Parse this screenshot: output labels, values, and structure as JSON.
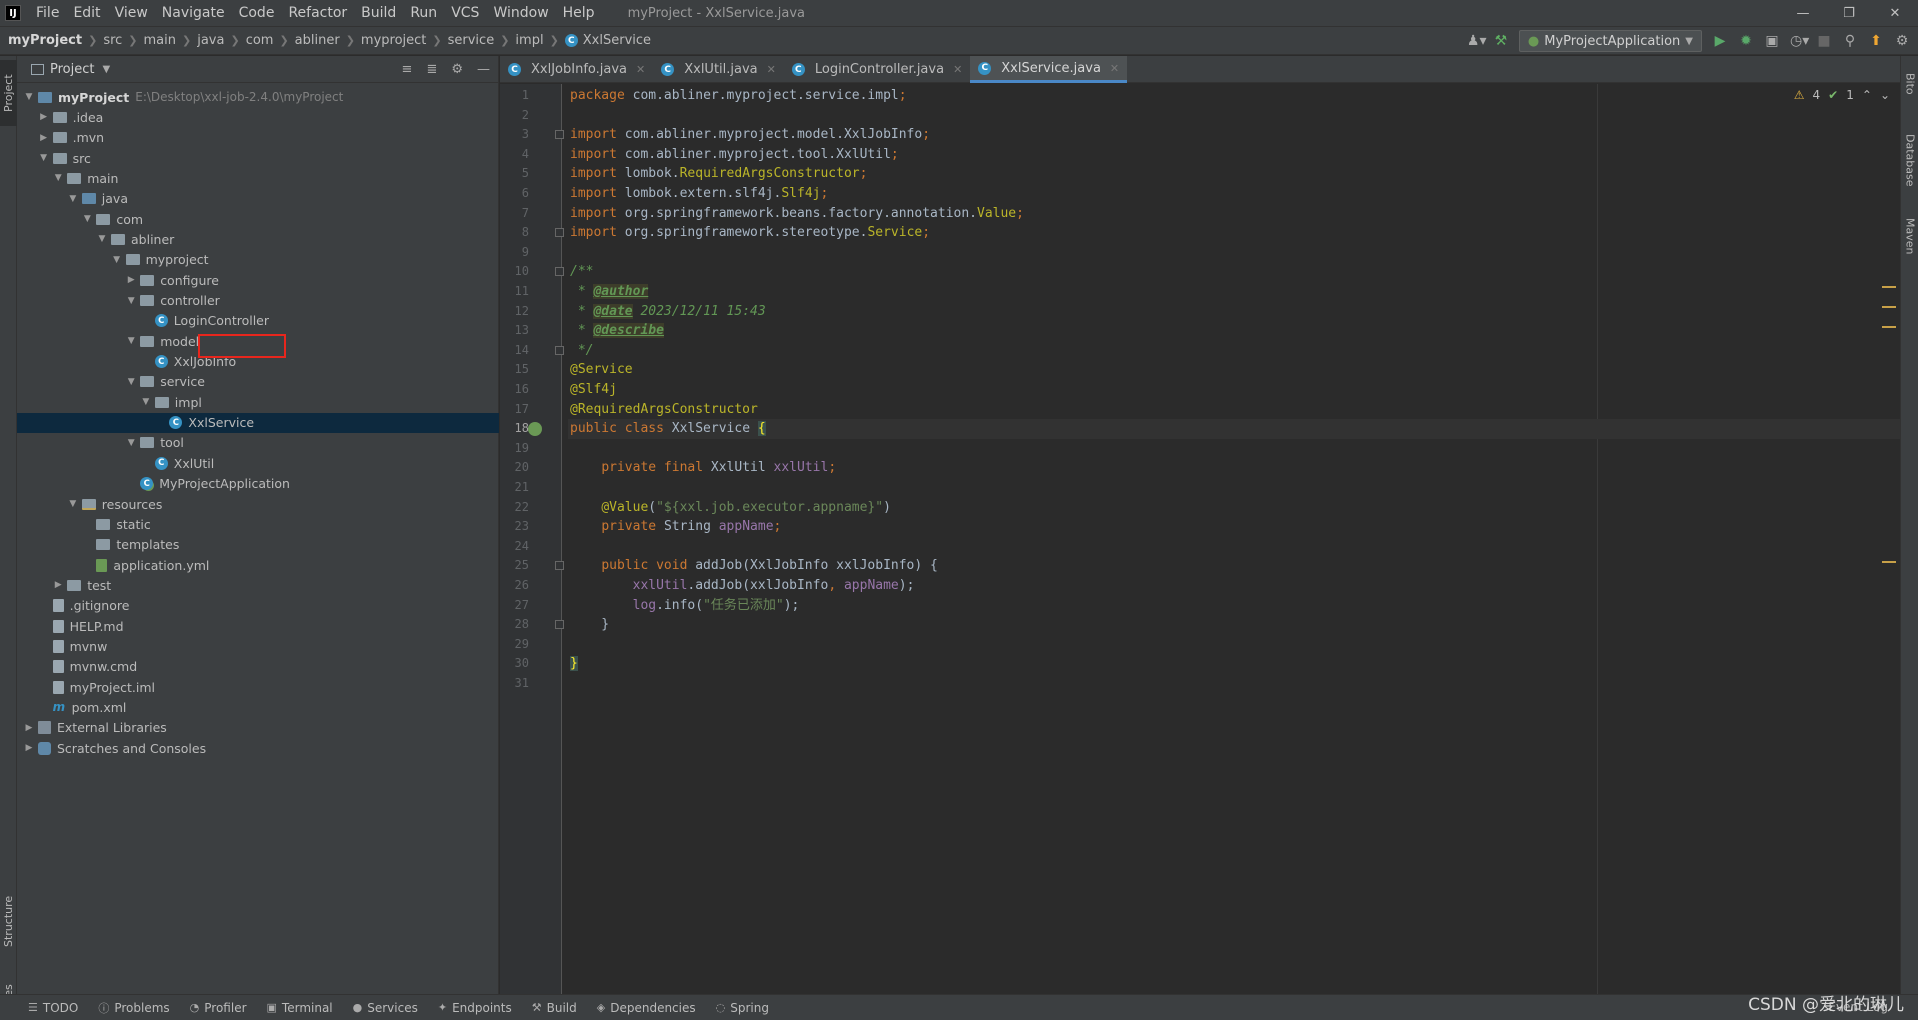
{
  "menubar": {
    "logo": "IJ",
    "items": [
      "File",
      "Edit",
      "View",
      "Navigate",
      "Code",
      "Refactor",
      "Build",
      "Run",
      "VCS",
      "Window",
      "Help"
    ],
    "window_title": "myProject - XxlService.java"
  },
  "breadcrumb": [
    "myProject",
    "src",
    "main",
    "java",
    "com",
    "abliner",
    "myproject",
    "service",
    "impl",
    "XxlService"
  ],
  "run_config": "MyProjectApplication",
  "left_tabs": {
    "project": "Project",
    "structure": "Structure",
    "favorites": "Favorites"
  },
  "right_tabs": {
    "bito": "Bito",
    "database": "Database",
    "maven": "Maven"
  },
  "project_panel": {
    "title": "Project"
  },
  "tree": [
    {
      "label": "myProject",
      "hint": "E:\\Desktop\\xxl-job-2.4.0\\myProject",
      "depth": 0,
      "arrow": "down",
      "icon": "folder-blue",
      "bold": true
    },
    {
      "label": ".idea",
      "depth": 1,
      "arrow": "right",
      "icon": "folder"
    },
    {
      "label": ".mvn",
      "depth": 1,
      "arrow": "right",
      "icon": "folder"
    },
    {
      "label": "src",
      "depth": 1,
      "arrow": "down",
      "icon": "folder"
    },
    {
      "label": "main",
      "depth": 2,
      "arrow": "down",
      "icon": "folder"
    },
    {
      "label": "java",
      "depth": 3,
      "arrow": "down",
      "icon": "folder-blue"
    },
    {
      "label": "com",
      "depth": 4,
      "arrow": "down",
      "icon": "folder"
    },
    {
      "label": "abliner",
      "depth": 5,
      "arrow": "down",
      "icon": "folder"
    },
    {
      "label": "myproject",
      "depth": 6,
      "arrow": "down",
      "icon": "folder"
    },
    {
      "label": "configure",
      "depth": 7,
      "arrow": "right",
      "icon": "folder"
    },
    {
      "label": "controller",
      "depth": 7,
      "arrow": "down",
      "icon": "folder"
    },
    {
      "label": "LoginController",
      "depth": 8,
      "arrow": "none",
      "icon": "class"
    },
    {
      "label": "model",
      "depth": 7,
      "arrow": "down",
      "icon": "folder"
    },
    {
      "label": "XxlJobInfo",
      "depth": 8,
      "arrow": "none",
      "icon": "class"
    },
    {
      "label": "service",
      "depth": 7,
      "arrow": "down",
      "icon": "folder"
    },
    {
      "label": "impl",
      "depth": 8,
      "arrow": "down",
      "icon": "folder"
    },
    {
      "label": "XxlService",
      "depth": 9,
      "arrow": "none",
      "icon": "class",
      "selected": true
    },
    {
      "label": "tool",
      "depth": 7,
      "arrow": "down",
      "icon": "folder"
    },
    {
      "label": "XxlUtil",
      "depth": 8,
      "arrow": "none",
      "icon": "class"
    },
    {
      "label": "MyProjectApplication",
      "depth": 7,
      "arrow": "none",
      "icon": "class-spring"
    },
    {
      "label": "resources",
      "depth": 3,
      "arrow": "down",
      "icon": "folder-res"
    },
    {
      "label": "static",
      "depth": 4,
      "arrow": "none",
      "icon": "folder"
    },
    {
      "label": "templates",
      "depth": 4,
      "arrow": "none",
      "icon": "folder"
    },
    {
      "label": "application.yml",
      "depth": 4,
      "arrow": "none",
      "icon": "yml"
    },
    {
      "label": "test",
      "depth": 2,
      "arrow": "right",
      "icon": "folder"
    },
    {
      "label": ".gitignore",
      "depth": 1,
      "arrow": "none",
      "icon": "file"
    },
    {
      "label": "HELP.md",
      "depth": 1,
      "arrow": "none",
      "icon": "file"
    },
    {
      "label": "mvnw",
      "depth": 1,
      "arrow": "none",
      "icon": "file"
    },
    {
      "label": "mvnw.cmd",
      "depth": 1,
      "arrow": "none",
      "icon": "file"
    },
    {
      "label": "myProject.iml",
      "depth": 1,
      "arrow": "none",
      "icon": "file"
    },
    {
      "label": "pom.xml",
      "depth": 1,
      "arrow": "none",
      "icon": "maven"
    },
    {
      "label": "External Libraries",
      "depth": 0,
      "arrow": "right",
      "icon": "lib"
    },
    {
      "label": "Scratches and Consoles",
      "depth": 0,
      "arrow": "right",
      "icon": "scratch"
    }
  ],
  "editor_tabs": [
    {
      "label": "XxlJobInfo.java",
      "active": false
    },
    {
      "label": "XxlUtil.java",
      "active": false
    },
    {
      "label": "LoginController.java",
      "active": false
    },
    {
      "label": "XxlService.java",
      "active": true
    }
  ],
  "inspections": {
    "warnings": "4",
    "weak_warnings": "1"
  },
  "code_lines": [
    [
      [
        "kw",
        "package "
      ],
      [
        "",
        "com.abliner.myproject.service.impl"
      ],
      [
        "kw",
        ";"
      ]
    ],
    [],
    [
      [
        "kw",
        "import "
      ],
      [
        "",
        "com.abliner.myproject.model.XxlJobInfo"
      ],
      [
        "kw",
        ";"
      ]
    ],
    [
      [
        "kw",
        "import "
      ],
      [
        "",
        "com.abliner.myproject.tool.XxlUtil"
      ],
      [
        "kw",
        ";"
      ]
    ],
    [
      [
        "kw",
        "import "
      ],
      [
        "",
        "lombok."
      ],
      [
        "ann",
        "RequiredArgsConstructor"
      ],
      [
        "kw",
        ";"
      ]
    ],
    [
      [
        "kw",
        "import "
      ],
      [
        "",
        "lombok.extern.slf4j."
      ],
      [
        "ann",
        "Slf4j"
      ],
      [
        "kw",
        ";"
      ]
    ],
    [
      [
        "kw",
        "import "
      ],
      [
        "",
        "org.springframework.beans.factory.annotation."
      ],
      [
        "ann",
        "Value"
      ],
      [
        "kw",
        ";"
      ]
    ],
    [
      [
        "kw",
        "import "
      ],
      [
        "",
        "org.springframework.stereotype."
      ],
      [
        "ann",
        "Service"
      ],
      [
        "kw",
        ";"
      ]
    ],
    [],
    [
      [
        "cmt",
        "/**"
      ]
    ],
    [
      [
        "cmt",
        " * "
      ],
      [
        "tag",
        "@author"
      ]
    ],
    [
      [
        "cmt",
        " * "
      ],
      [
        "tag",
        "@date"
      ],
      [
        "cmt",
        " 2023/12/11 15:43"
      ]
    ],
    [
      [
        "cmt",
        " * "
      ],
      [
        "tag",
        "@describe"
      ]
    ],
    [
      [
        "cmt",
        " */"
      ]
    ],
    [
      [
        "ann",
        "@Service"
      ]
    ],
    [
      [
        "ann",
        "@Slf4j"
      ]
    ],
    [
      [
        "ann",
        "@RequiredArgsConstructor"
      ]
    ],
    [
      [
        "kw",
        "public class "
      ],
      [
        "",
        "XxlService "
      ],
      [
        "brace",
        "{"
      ]
    ],
    [],
    [
      [
        "",
        "    "
      ],
      [
        "kw",
        "private final "
      ],
      [
        "",
        "XxlUtil "
      ],
      [
        "fld",
        "xxlUtil"
      ],
      [
        "kw",
        ";"
      ]
    ],
    [],
    [
      [
        "",
        "    "
      ],
      [
        "ann",
        "@Value"
      ],
      [
        "",
        "("
      ],
      [
        "str",
        "\"${xxl.job.executor.appname}\""
      ],
      [
        "",
        ")"
      ]
    ],
    [
      [
        "",
        "    "
      ],
      [
        "kw",
        "private "
      ],
      [
        "",
        "String "
      ],
      [
        "fld",
        "appName"
      ],
      [
        "kw",
        ";"
      ]
    ],
    [],
    [
      [
        "",
        "    "
      ],
      [
        "kw",
        "public void "
      ],
      [
        "",
        "addJob(XxlJobInfo xxlJobInfo) {"
      ]
    ],
    [
      [
        "",
        "        "
      ],
      [
        "fld",
        "xxlUtil"
      ],
      [
        "",
        ".addJob(xxlJobInfo"
      ],
      [
        "kw",
        ", "
      ],
      [
        "fld",
        "appName"
      ],
      [
        "",
        "); "
      ]
    ],
    [
      [
        "",
        "        "
      ],
      [
        "fld",
        "log"
      ],
      [
        "",
        ".info("
      ],
      [
        "str",
        "\"任务已添加\""
      ],
      [
        "",
        ");"
      ]
    ],
    [
      [
        "",
        "    }"
      ]
    ],
    [],
    [
      [
        "brace",
        "}"
      ]
    ],
    []
  ],
  "bottom_tools": [
    "TODO",
    "Problems",
    "Profiler",
    "Terminal",
    "Services",
    "Endpoints",
    "Build",
    "Dependencies",
    "Spring"
  ],
  "event_log": "Event Log",
  "watermark": "CSDN @爱北的琳儿"
}
